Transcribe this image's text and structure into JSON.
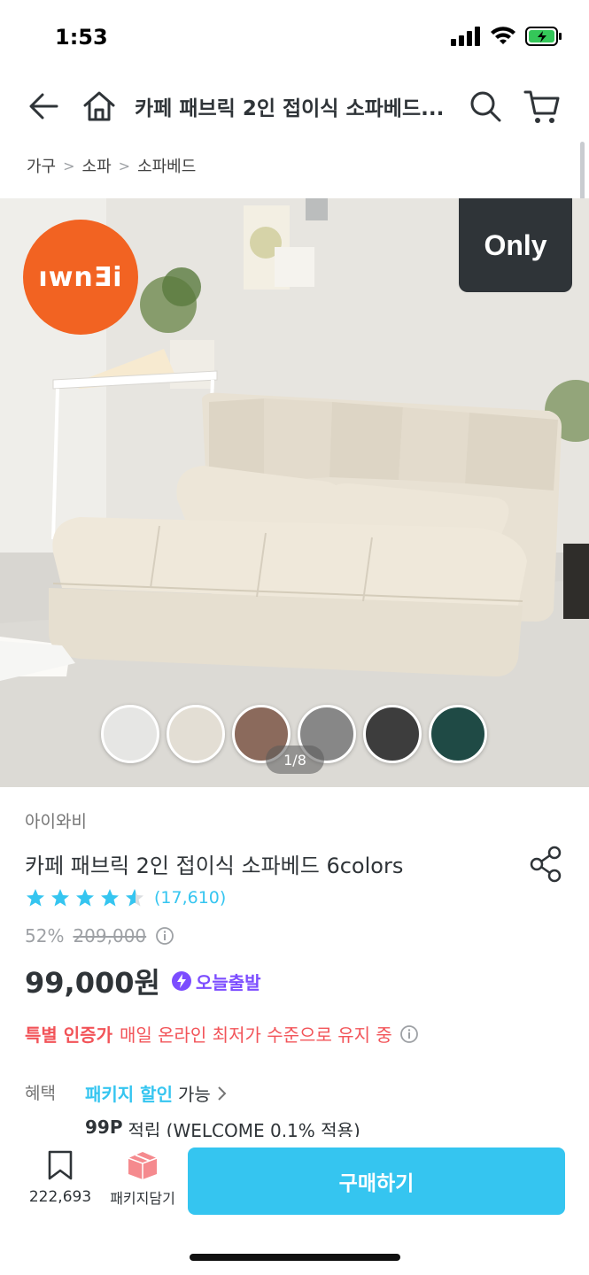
{
  "status_bar": {
    "time": "1:53"
  },
  "header": {
    "title": "카페 패브릭 2인 접이식 소파베드..."
  },
  "breadcrumb": [
    "가구",
    "소파",
    "소파베드"
  ],
  "hero": {
    "brand_badge": "ıwnƎi",
    "only_badge": "Only",
    "page_indicator": "1/8",
    "swatch_colors": [
      "#e6e6e4",
      "#e3ded4",
      "#8b6a5c",
      "#878787",
      "#3d3d3d",
      "#1f4a45"
    ]
  },
  "product": {
    "brand": "아이와비",
    "title": "카페 패브릭 2인 접이식 소파베드 6colors",
    "rating": 4.5,
    "review_count": "(17,610)",
    "discount": "52%",
    "original_price": "209,000",
    "price": "99,000원",
    "today_badge": "오늘출발",
    "special_strong": "특별 인증가",
    "special_text": "매일 온라인 최저가 수준으로 유지 중",
    "benefit_label": "혜택",
    "benefit_link": "패키지 할인",
    "benefit_after": "가능",
    "points_strong": "99P",
    "points_text": "적립 (WELCOME 0.1% 적용)"
  },
  "bottom_bar": {
    "bookmark_count": "222,693",
    "package_label": "패키지담기",
    "buy_label": "구매하기"
  },
  "colors": {
    "accent": "#35c5f0",
    "discount_red": "#f25459",
    "today_purple": "#7c4dff"
  }
}
